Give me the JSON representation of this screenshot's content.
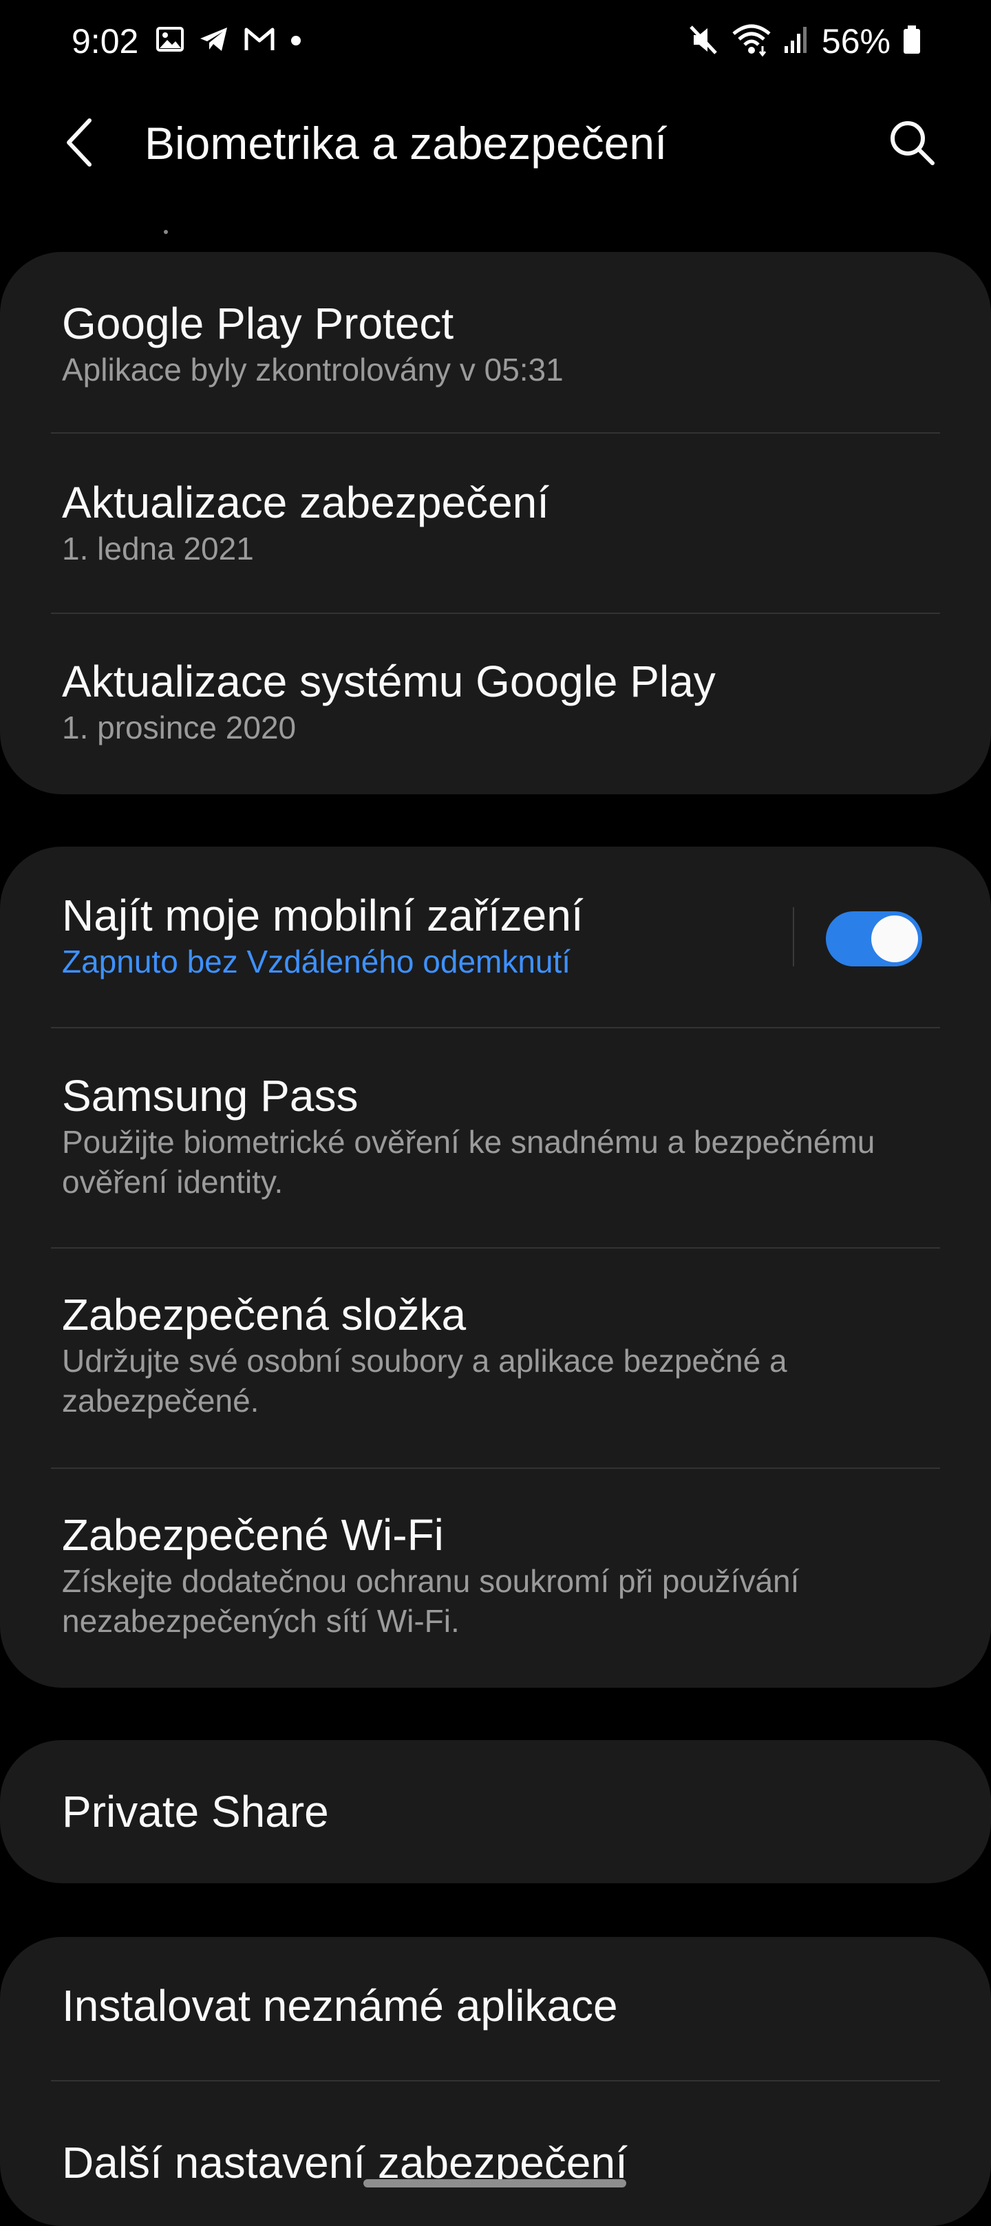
{
  "status_bar": {
    "time": "9:02",
    "left_icons": [
      "image-icon",
      "telegram-icon",
      "gmail-icon",
      "dot-icon"
    ],
    "right_icons": [
      "mute-icon",
      "wifi-icon",
      "signal-icon",
      "battery-icon"
    ],
    "battery": "56%"
  },
  "header": {
    "title": "Biometrika a zabezpečení",
    "back_icon": "back-arrow-icon",
    "search_icon": "search-icon"
  },
  "cards": [
    {
      "items": [
        {
          "title": "Google Play Protect",
          "subtitle": "Aplikace byly zkontrolovány v 05:31"
        },
        {
          "title": "Aktualizace zabezpečení",
          "subtitle": "1. ledna 2021"
        },
        {
          "title": "Aktualizace systému Google Play",
          "subtitle": "1. prosince 2020"
        }
      ]
    },
    {
      "items": [
        {
          "title": "Najít moje mobilní zařízení",
          "subtitle": "Zapnuto bez Vzdáleného odemknutí",
          "toggle": true
        },
        {
          "title": "Samsung Pass",
          "subtitle_lines": [
            "Použijte biometrické ověření ke snadnému a bezpečnému",
            "ověření identity."
          ]
        },
        {
          "title": "Zabezpečená složka",
          "subtitle_lines": [
            "Udržujte své osobní soubory a aplikace bezpečné a",
            "zabezpečené."
          ]
        },
        {
          "title": "Zabezpečené Wi-Fi",
          "subtitle_lines": [
            "Získejte dodatečnou ochranu soukromí při používání",
            "nezabezpečených sítí Wi-Fi."
          ]
        }
      ]
    },
    {
      "items": [
        {
          "title": "Private Share"
        }
      ]
    },
    {
      "items": [
        {
          "title": "Instalovat neznámé aplikace"
        },
        {
          "title": "Další nastavení zabezpečení"
        }
      ]
    }
  ],
  "colors": {
    "background": "#000000",
    "card": "#1b1b1b",
    "accent": "#3e91ff",
    "toggle_on": "#2a7fe8",
    "secondary_text": "#9b9b9b"
  }
}
